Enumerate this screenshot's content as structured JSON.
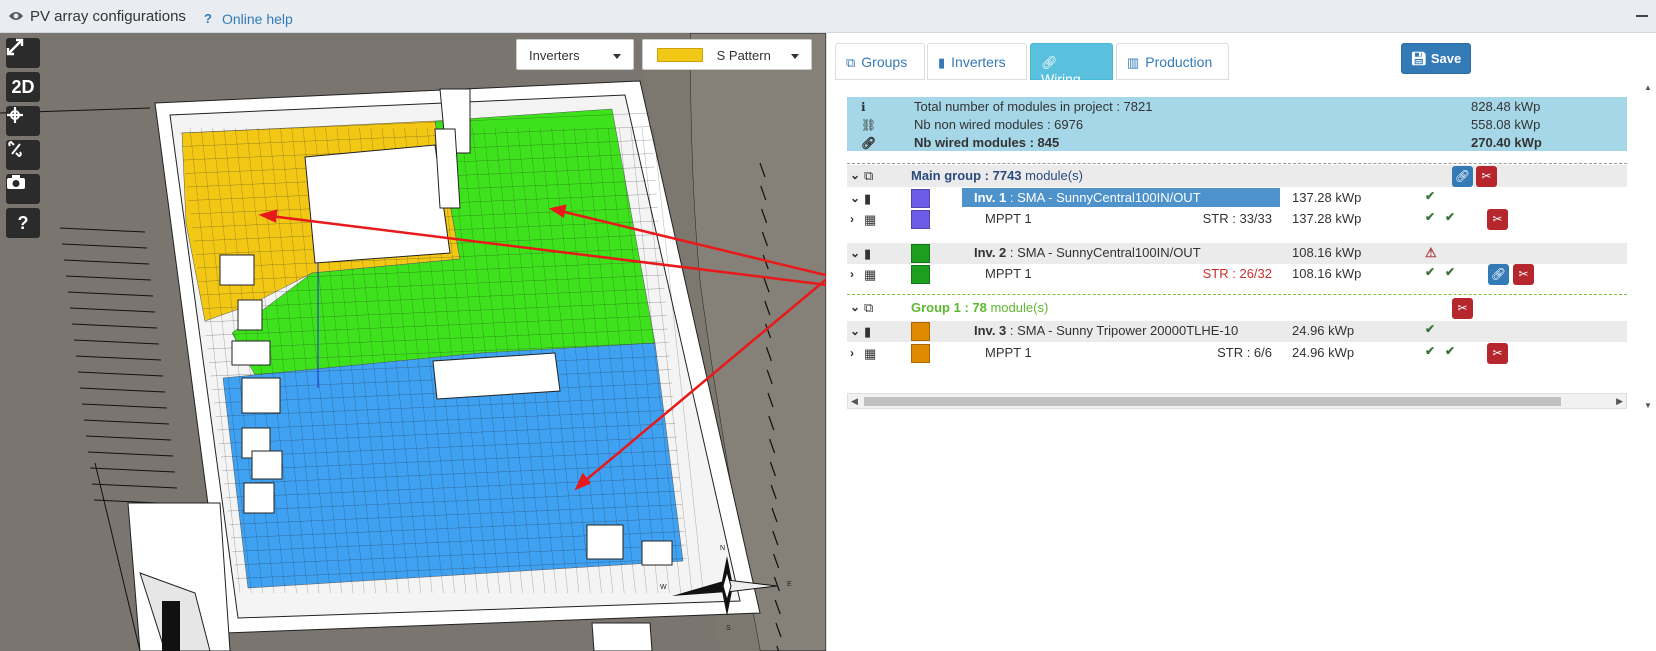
{
  "titlebar": {
    "title": "PV array configurations",
    "help_mark": "?",
    "help_label": "Online help"
  },
  "viewport": {
    "tools": [
      "2D",
      "?"
    ],
    "inverters_dropdown": "Inverters",
    "pattern_dropdown": "S Pattern",
    "compass": {
      "n": "N",
      "s": "S",
      "e": "E",
      "w": "W"
    },
    "colors": {
      "yellow": "#f2c815",
      "green": "#3ee21c",
      "blue": "#3fa1f2",
      "arrow": "#e8191a"
    }
  },
  "tabs": [
    {
      "label": "Groups",
      "icon": "groups-icon"
    },
    {
      "label": "Inverters",
      "icon": "inverter-icon"
    },
    {
      "label": "Wiring",
      "icon": "link-icon",
      "active": true
    },
    {
      "label": "Production",
      "icon": "bar-chart-icon"
    }
  ],
  "save_label": "Save",
  "summary": {
    "total_label": "Total number of modules in project : 7821",
    "total_kwp": "828.48 kWp",
    "nonwired_label": "Nb non wired modules : 6976",
    "nonwired_kwp": "558.08 kWp",
    "wired_label": "Nb wired modules : 845",
    "wired_kwp": "270.40 kWp"
  },
  "tree": {
    "main_group": {
      "prefix": "Main group : ",
      "count": "7743",
      "suffix": " module(s)"
    },
    "inv1": {
      "id": "Inv. 1",
      "model": " : SMA - SunnyCentral100IN/OUT",
      "kwp": "137.28 kWp",
      "color": "#6c5ce7"
    },
    "inv1_mppt": {
      "label": "MPPT 1",
      "str": "STR : 33/33",
      "kwp": "137.28 kWp",
      "color": "#6c5ce7"
    },
    "inv2": {
      "id": "Inv. 2",
      "model": " : SMA - SunnyCentral100IN/OUT",
      "kwp": "108.16 kWp",
      "color": "#1e9e1e"
    },
    "inv2_mppt": {
      "label": "MPPT 1",
      "str": "STR : 26/32",
      "kwp": "108.16 kWp",
      "color": "#1e9e1e"
    },
    "group1": {
      "prefix": "Group 1 : ",
      "count": "78",
      "suffix": " module(s)"
    },
    "inv3": {
      "id": "Inv. 3",
      "model": " : SMA - Sunny Tripower 20000TLHE-10",
      "kwp": "24.96 kWp",
      "color": "#e08a00"
    },
    "inv3_mppt": {
      "label": "MPPT 1",
      "str": "STR : 6/6",
      "kwp": "24.96 kWp",
      "color": "#e08a00"
    }
  }
}
